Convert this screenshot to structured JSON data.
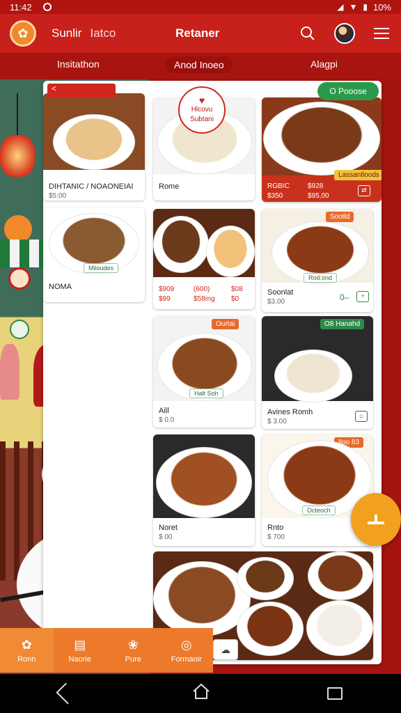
{
  "status_bar": {
    "time": "11:42",
    "battery": "10%"
  },
  "header": {
    "brand_a": "Sunlir",
    "brand_b": "Iatco",
    "title": "Retaner"
  },
  "subtabs": [
    "Insitathon",
    "Anod Inoeo",
    "Alagpi"
  ],
  "panel_top": {
    "back_tag": "<",
    "badge_line1": "Hlcovu",
    "badge_line2": "Subtani",
    "badge_icon": "♥",
    "mini_num": "\u0018 \u0018",
    "fab_green": "O Pooose"
  },
  "cards": [
    {
      "name": "DIHTANIC / NOAONEIAI",
      "price": "$5:00"
    },
    {
      "name": "Rome",
      "price": ""
    },
    {
      "name": "",
      "price": "",
      "stats": [
        "RGBIC",
        "$928",
        "$350",
        "$95,00"
      ],
      "tag": "Lassantloods"
    },
    {
      "name": "NOMA",
      "price": "",
      "pill": "Mlioudes"
    },
    {
      "name": "",
      "price": "",
      "stats": [
        "$909",
        "(600)",
        "$08",
        "$99",
        "$58mg",
        "$0"
      ]
    },
    {
      "name": "Soonlat",
      "price": "$3.00",
      "pill": "Rod:ond",
      "tag": "Sootld",
      "extra": "0–"
    },
    {
      "name": "Aill",
      "price": "$ 0.0",
      "pill": "Halt Soh",
      "tag": "Ourtai"
    },
    {
      "name": "Avines Romh",
      "price": "$ 3.00",
      "tag": "O8 Hanahd"
    },
    {
      "name": "Noret",
      "price": "$ 00",
      "tag": ""
    },
    {
      "name": "Rnto",
      "price": "$ 700",
      "pill": "Octeoch",
      "tag": "Iloo 83"
    }
  ],
  "bottom_nav": [
    {
      "label": "Ronn",
      "icon": "home"
    },
    {
      "label": "Naorie",
      "icon": "menu"
    },
    {
      "label": "Pure",
      "icon": "flower"
    },
    {
      "label": "Formaoir",
      "icon": "globe"
    }
  ],
  "colors": {
    "primary": "#c8201a",
    "accent": "#ec7a2a",
    "green": "#2a9a4a"
  }
}
